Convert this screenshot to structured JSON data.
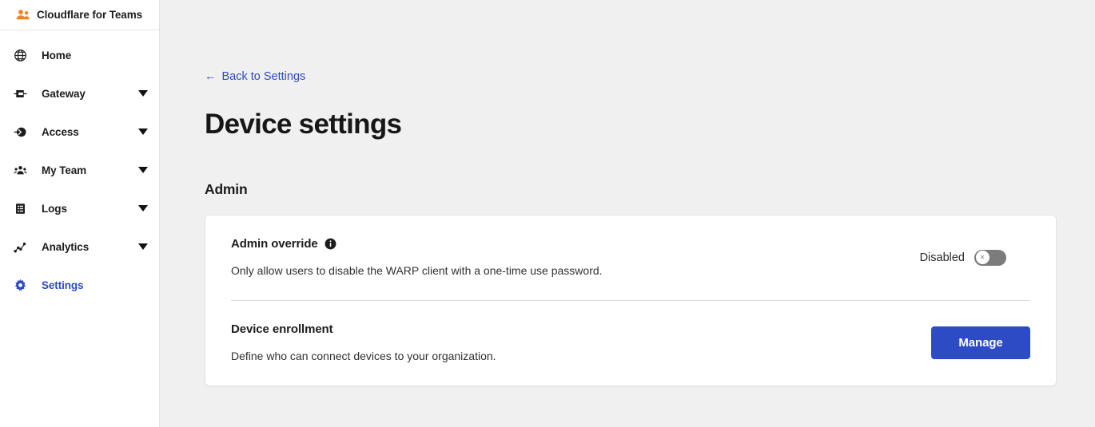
{
  "brand": {
    "title": "Cloudflare for Teams",
    "logo_icon": "teams-people-icon",
    "logo_color": "#f6821f"
  },
  "sidebar": {
    "items": [
      {
        "label": "Home",
        "icon": "globe-icon",
        "has_caret": false,
        "active": false
      },
      {
        "label": "Gateway",
        "icon": "gateway-icon",
        "has_caret": true,
        "active": false
      },
      {
        "label": "Access",
        "icon": "access-icon",
        "has_caret": true,
        "active": false
      },
      {
        "label": "My Team",
        "icon": "people-icon",
        "has_caret": true,
        "active": false
      },
      {
        "label": "Logs",
        "icon": "logs-icon",
        "has_caret": true,
        "active": false
      },
      {
        "label": "Analytics",
        "icon": "analytics-icon",
        "has_caret": true,
        "active": false
      },
      {
        "label": "Settings",
        "icon": "gear-icon",
        "has_caret": false,
        "active": true
      }
    ],
    "active_color": "#2c4bc4"
  },
  "main": {
    "back_link": {
      "arrow": "←",
      "label": "Back to Settings"
    },
    "page_title": "Device settings",
    "sections": [
      {
        "title": "Admin",
        "rows": [
          {
            "heading": "Admin override",
            "info_icon": "info-icon",
            "description": "Only allow users to disable the WARP client with a one-time use password.",
            "control": "toggle",
            "toggle_label": "Disabled",
            "toggle_on": false,
            "toggle_knob_glyph": "✕"
          },
          {
            "heading": "Device enrollment",
            "description": "Define who can connect devices to your organization.",
            "control": "button",
            "button_label": "Manage"
          }
        ]
      }
    ]
  },
  "colors": {
    "accent": "#2c4bc4",
    "brand_orange": "#f6821f",
    "page_bg": "#f0f0f0",
    "card_bg": "#ffffff",
    "toggle_off": "#7c7c7c"
  }
}
